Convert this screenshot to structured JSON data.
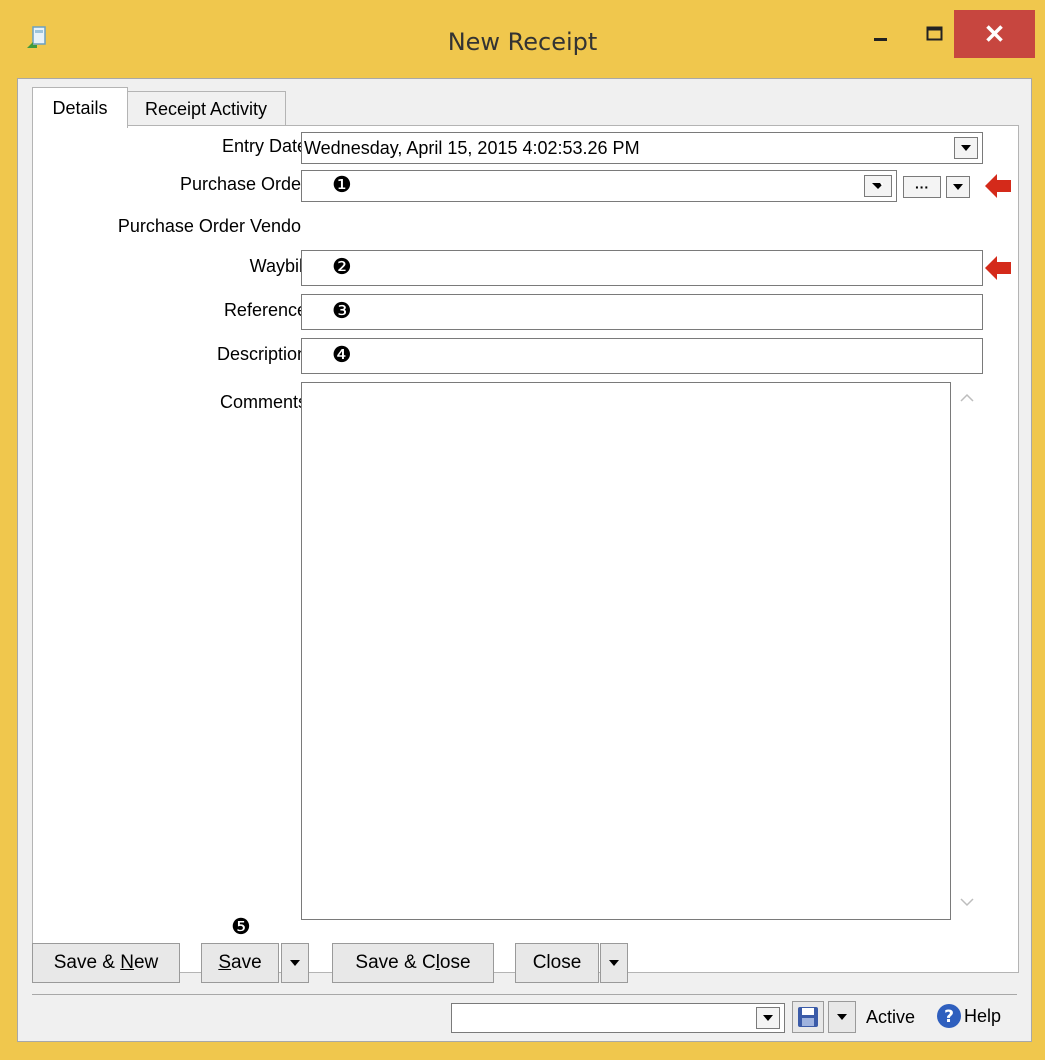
{
  "window": {
    "title": "New Receipt",
    "close_glyph": "✕",
    "minimize_glyph": "—",
    "maximize_glyph": "☐"
  },
  "tabs": [
    {
      "label": "Details",
      "active": true
    },
    {
      "label": "Receipt Activity",
      "active": false
    }
  ],
  "form": {
    "entry_date": {
      "label": "Entry Date",
      "value": "Wednesday, April 15, 2015 4:02:53.26 PM"
    },
    "purchase_order": {
      "label": "Purchase Order",
      "value": "",
      "marker": "❶",
      "ellipsis": "···"
    },
    "purchase_order_vendor": {
      "label": "Purchase Order Vendor",
      "value": ""
    },
    "waybill": {
      "label": "Waybill",
      "value": "",
      "marker": "❷"
    },
    "reference": {
      "label": "Reference",
      "value": "",
      "marker": "❸"
    },
    "description": {
      "label": "Description",
      "value": "",
      "marker": "❹"
    },
    "comments": {
      "label": "Comments",
      "value": ""
    }
  },
  "buttons": {
    "save_new": {
      "pre": "Save & ",
      "u": "N",
      "post": "ew"
    },
    "save": {
      "pre": "",
      "u": "S",
      "post": "ave",
      "marker": "❺"
    },
    "save_close": {
      "pre": "Save & C",
      "u": "l",
      "post": "ose"
    },
    "close": {
      "label": "Close"
    }
  },
  "status": {
    "status_value": "",
    "active_label": "Active",
    "help_label": "Help"
  },
  "colors": {
    "frame": "#f0c74d",
    "close_button": "#c7463f",
    "arrow_marker": "#d42a1a"
  }
}
